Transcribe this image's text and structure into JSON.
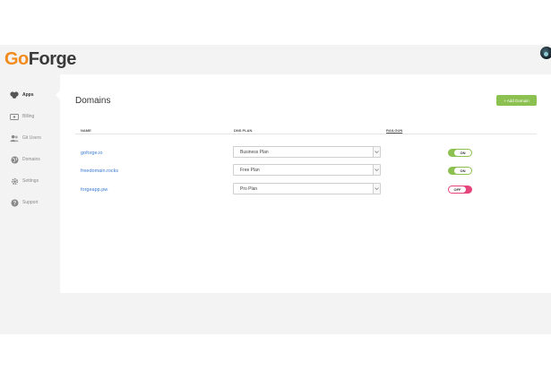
{
  "brand": {
    "name_part1": "Go",
    "name_part2": "Forge"
  },
  "sidebar": {
    "items": [
      {
        "label": "Apps",
        "icon": "apps-icon",
        "active": true
      },
      {
        "label": "Billing",
        "icon": "billing-icon",
        "active": false
      },
      {
        "label": "Git Users",
        "icon": "users-icon",
        "active": false
      },
      {
        "label": "Domains",
        "icon": "globe-icon",
        "active": false
      },
      {
        "label": "Settings",
        "icon": "gear-icon",
        "active": false
      },
      {
        "label": "Support",
        "icon": "help-icon",
        "active": false
      }
    ]
  },
  "main": {
    "title": "Domains",
    "add_button": "+ Add Domain",
    "columns": {
      "name": "NAME",
      "dns_plan": "DNS PLAN",
      "railgun": "RAILGUN"
    },
    "rows": [
      {
        "domain": "goforge.io",
        "plan": "Business Plan",
        "railgun": "ON"
      },
      {
        "domain": "freedomain.rocks",
        "plan": "Free Plan",
        "railgun": "ON"
      },
      {
        "domain": "forgeapp.pw",
        "plan": "Pro Plan",
        "railgun": "OFF"
      }
    ]
  },
  "colors": {
    "accent_green": "#8cc152",
    "toggle_off": "#e5457a",
    "link_blue": "#3b7bd1",
    "brand_orange": "#f28a1c"
  }
}
